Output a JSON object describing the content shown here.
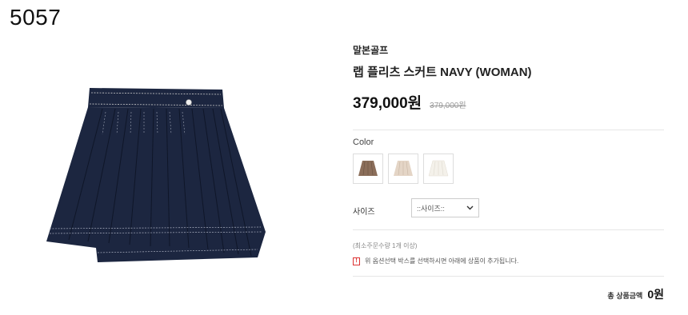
{
  "overlay_id": "5057",
  "product": {
    "brand": "말본골프",
    "title": "랩 플리츠 스커트 NAVY (WOMAN)",
    "price": "379,000원",
    "original_price": "379,000원",
    "image_icon": "pleated-skirt-image",
    "colors": {
      "navy": "#1c2640"
    }
  },
  "options": {
    "color_label": "Color",
    "swatches": [
      {
        "name": "brown",
        "color": "#8b6e5a"
      },
      {
        "name": "beige",
        "color": "#e4d5c6"
      },
      {
        "name": "ivory",
        "color": "#f4f1ea"
      }
    ],
    "size_label": "사이즈",
    "size_select": "::사이즈::"
  },
  "purchase": {
    "min_qty_text": "(최소주문수량 1개 이상)",
    "notice_icon": "!",
    "notice_text": "위 옵션선택 박스를 선택하시면 아래에 상품이 추가됩니다.",
    "total_label": "총 상품금액",
    "total_value": "0원"
  }
}
